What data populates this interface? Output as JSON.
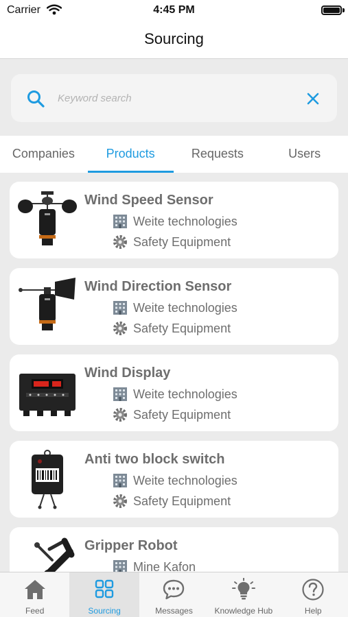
{
  "status_bar": {
    "carrier": "Carrier",
    "time": "4:45 PM"
  },
  "header": {
    "title": "Sourcing"
  },
  "search": {
    "placeholder": "Keyword search",
    "value": ""
  },
  "tabs": [
    {
      "label": "Companies",
      "active": false
    },
    {
      "label": "Products",
      "active": true
    },
    {
      "label": "Requests",
      "active": false
    },
    {
      "label": "Users",
      "active": false
    }
  ],
  "products": [
    {
      "title": "Wind Speed Sensor",
      "company": "Weite technologies",
      "category": "Safety Equipment",
      "thumbnail": "anemometer"
    },
    {
      "title": "Wind Direction Sensor",
      "company": "Weite technologies",
      "category": "Safety Equipment",
      "thumbnail": "wind-vane"
    },
    {
      "title": "Wind Display",
      "company": "Weite technologies",
      "category": "Safety Equipment",
      "thumbnail": "display-unit"
    },
    {
      "title": "Anti two block switch",
      "company": "Weite technologies",
      "category": "Safety Equipment",
      "thumbnail": "limit-switch"
    },
    {
      "title": "Gripper Robot",
      "company": "Mine Kafon",
      "category": "",
      "thumbnail": "robot-arm"
    }
  ],
  "tab_bar": [
    {
      "label": "Feed",
      "icon": "home-icon",
      "active": false
    },
    {
      "label": "Sourcing",
      "icon": "grid-icon",
      "active": true
    },
    {
      "label": "Messages",
      "icon": "chat-bubble-icon",
      "active": false
    },
    {
      "label": "Knowledge Hub",
      "icon": "lightbulb-icon",
      "active": false
    },
    {
      "label": "Help",
      "icon": "question-icon",
      "active": false
    }
  ],
  "colors": {
    "accent": "#1e9be0",
    "muted_text": "#6e6e6e",
    "background": "#ebebeb"
  }
}
